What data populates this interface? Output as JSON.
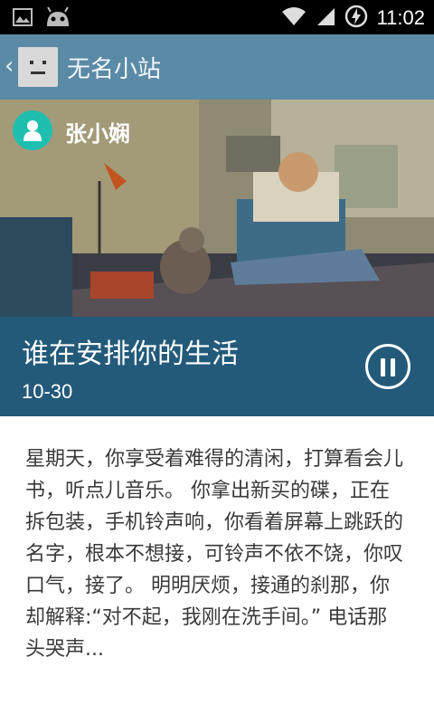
{
  "status_bar": {
    "time": "11:02",
    "icons": [
      "image-icon",
      "android-icon",
      "wifi-icon",
      "signal-icon",
      "battery-charging-icon"
    ]
  },
  "app_bar": {
    "title": "无名小站",
    "icon": "app-avatar-icon"
  },
  "hero": {
    "author_name": "张小娴"
  },
  "post": {
    "title": "谁在安排你的生活",
    "date": "10-30"
  },
  "content": {
    "excerpt": "星期天，你享受着难得的清闲，打算看会儿书，听点儿音乐。 你拿出新买的碟，正在拆包装，手机铃声响，你看着屏幕上跳跃的名字，根本不想接，可铃声不依不饶，你叹口气，接了。 明明厌烦，接通的刹那，你却解释:“对不起，我刚在洗手间。” 电话那头哭声..."
  },
  "colors": {
    "app_bar": "#5a8aa6",
    "info_bar": "#235a7a",
    "avatar": "#1fbfb0"
  }
}
